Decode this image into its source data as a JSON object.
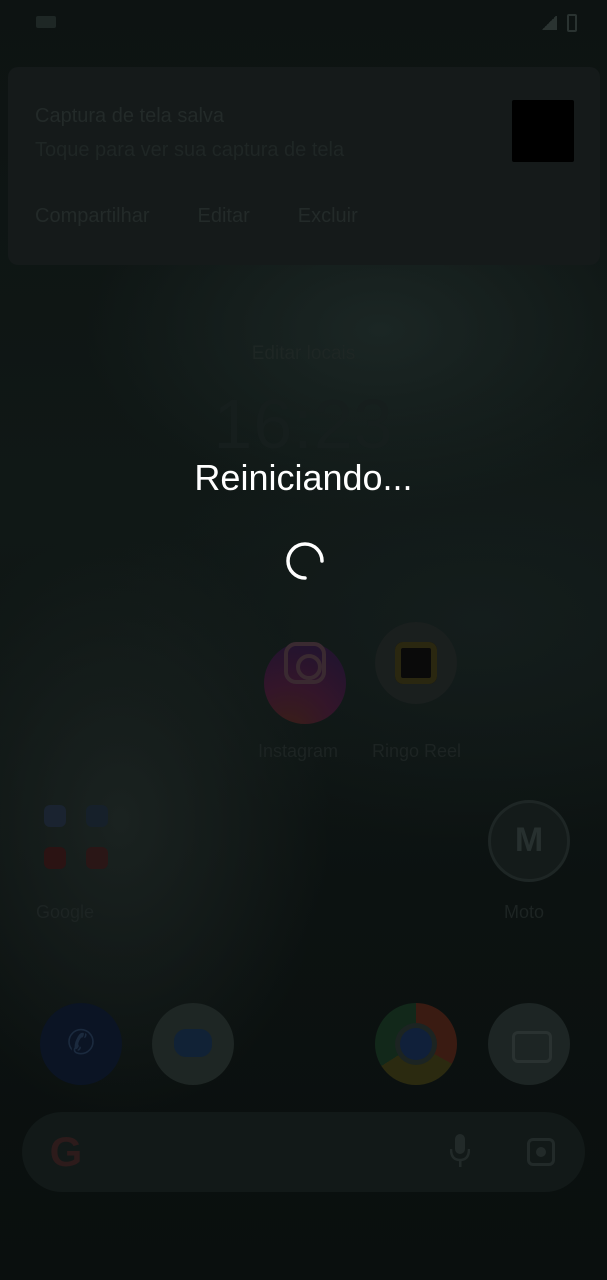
{
  "notification": {
    "title": "Captura de tela salva",
    "subtitle": "Toque para ver sua captura de tela",
    "actions": [
      "Compartilhar",
      "Editar",
      "Excluir"
    ]
  },
  "clock_widget": {
    "edit_label": "Editar locais",
    "time": "16:23"
  },
  "overlay": {
    "message": "Reiniciando...",
    "spinner_icon": "loading-spinner-icon"
  },
  "apps": {
    "instagram": "Instagram",
    "reel": "Ringo Reel",
    "google_folder": "Google",
    "moto": "Moto"
  },
  "dock": [
    "phone-icon",
    "messages-icon",
    "chrome-icon",
    "camera-icon"
  ],
  "search": {
    "google_icon": "google-g-icon",
    "mic_icon": "mic-icon",
    "lens_icon": "lens-icon"
  },
  "colors": {
    "overlay_text": "#ffffff",
    "background": "#0b100f"
  }
}
